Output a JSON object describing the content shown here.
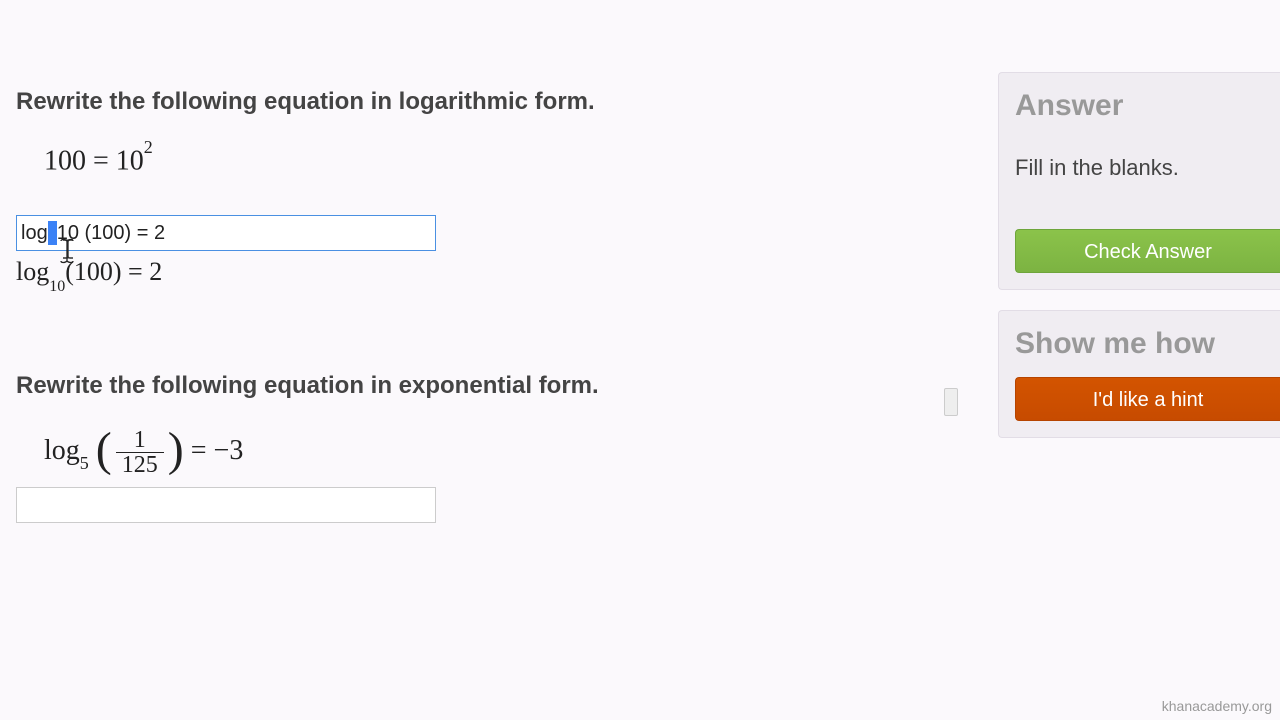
{
  "question1": {
    "prompt": "Rewrite the following equation in logarithmic form.",
    "eq_lhs": "100",
    "eq_eq": " = ",
    "eq_base": "10",
    "eq_exp": "2",
    "input_pre": "log",
    "input_post": "10 (100) = 2",
    "rendered_log": "log",
    "rendered_sub": "10",
    "rendered_rest": "(100) = 2"
  },
  "question2": {
    "prompt": "Rewrite the following equation in exponential form.",
    "eq_log": "log",
    "eq_sub": "5",
    "frac_num": "1",
    "frac_den": "125",
    "eq_rhs": " = −3"
  },
  "sidebar": {
    "answer_title": "Answer",
    "instruction": "Fill in the blanks.",
    "check_label": "Check Answer",
    "hint_title": "Show me how",
    "hint_label": "I'd like a hint"
  },
  "watermark": "khanacademy.org"
}
